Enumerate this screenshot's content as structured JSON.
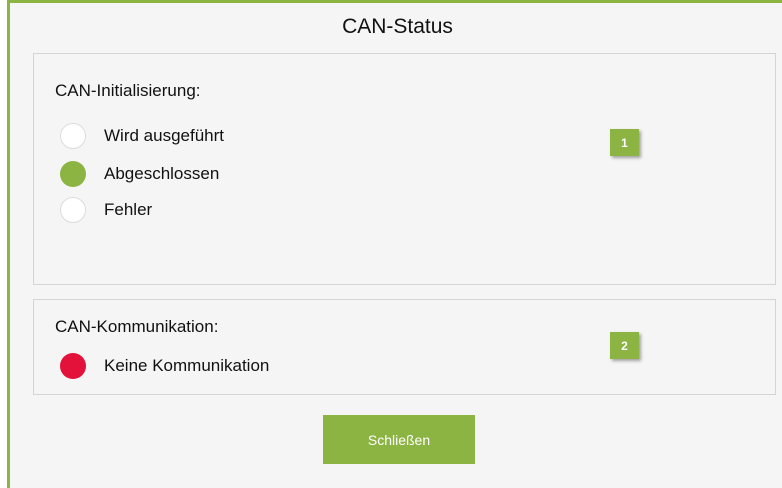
{
  "dialog": {
    "title": "CAN-Status",
    "close_label": "Schließen",
    "accent_color": "#8cb443"
  },
  "init_panel": {
    "heading": "CAN-Initialisierung:",
    "badge": "1",
    "options": [
      {
        "label": "Wird ausgeführt",
        "state": "inactive"
      },
      {
        "label": "Abgeschlossen",
        "state": "active-green"
      },
      {
        "label": "Fehler",
        "state": "inactive"
      }
    ]
  },
  "comm_panel": {
    "heading": "CAN-Kommunikation:",
    "badge": "2",
    "status": {
      "label": "Keine Kommunikation",
      "state": "active-red",
      "color": "#e2123a"
    }
  }
}
